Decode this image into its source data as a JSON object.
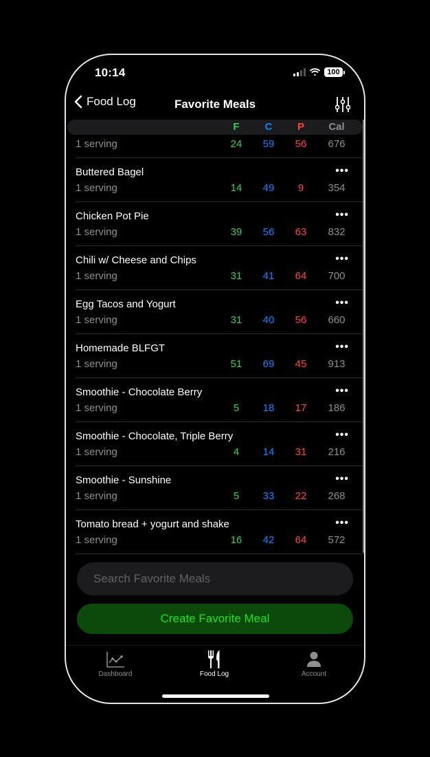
{
  "status_bar": {
    "time": "10:14",
    "battery": "100",
    "icons": [
      "cellular-signal-icon",
      "wifi-icon",
      "battery-icon"
    ]
  },
  "nav": {
    "back_label": "Food Log",
    "title": "Favorite Meals",
    "back_icon": "chevron-left-icon",
    "filter_icon": "sliders-icon"
  },
  "columns": {
    "fat": "F",
    "carbs": "C",
    "protein": "P",
    "calories": "Cal"
  },
  "colors": {
    "fat": "#30d158",
    "carbs": "#0a84ff",
    "protein": "#ff453a",
    "calories": "#8e8e93",
    "create_bg": "#0c4a0c",
    "create_text": "#22e022"
  },
  "partial_row": {
    "serving": "1 serving",
    "fat": "24",
    "carbs": "59",
    "protein": "56",
    "calories": "676"
  },
  "meals": [
    {
      "name": "Buttered Bagel",
      "serving": "1 serving",
      "fat": "14",
      "carbs": "49",
      "protein": "9",
      "calories": "354"
    },
    {
      "name": "Chicken Pot Pie",
      "serving": "1 serving",
      "fat": "39",
      "carbs": "56",
      "protein": "63",
      "calories": "832"
    },
    {
      "name": "Chili w/ Cheese and Chips",
      "serving": "1 serving",
      "fat": "31",
      "carbs": "41",
      "protein": "64",
      "calories": "700"
    },
    {
      "name": "Egg Tacos and Yogurt",
      "serving": "1 serving",
      "fat": "31",
      "carbs": "40",
      "protein": "56",
      "calories": "660"
    },
    {
      "name": "Homemade BLFGT",
      "serving": "1 serving",
      "fat": "51",
      "carbs": "69",
      "protein": "45",
      "calories": "913"
    },
    {
      "name": "Smoothie - Chocolate Berry",
      "serving": "1 serving",
      "fat": "5",
      "carbs": "18",
      "protein": "17",
      "calories": "186"
    },
    {
      "name": "Smoothie - Chocolate, Triple Berry",
      "serving": "1 serving",
      "fat": "4",
      "carbs": "14",
      "protein": "31",
      "calories": "216"
    },
    {
      "name": "Smoothie - Sunshine",
      "serving": "1 serving",
      "fat": "5",
      "carbs": "33",
      "protein": "22",
      "calories": "268"
    },
    {
      "name": "Tomato bread + yogurt and shake",
      "serving": "1 serving",
      "fat": "16",
      "carbs": "42",
      "protein": "64",
      "calories": "572"
    }
  ],
  "more_label": "•••",
  "search": {
    "placeholder": "Search Favorite Meals",
    "value": ""
  },
  "create_button": "Create Favorite Meal",
  "tabs": [
    {
      "label": "Dashboard",
      "icon": "chart-line-icon",
      "active": false
    },
    {
      "label": "Food Log",
      "icon": "fork-knife-icon",
      "active": true
    },
    {
      "label": "Account",
      "icon": "person-icon",
      "active": false
    }
  ]
}
